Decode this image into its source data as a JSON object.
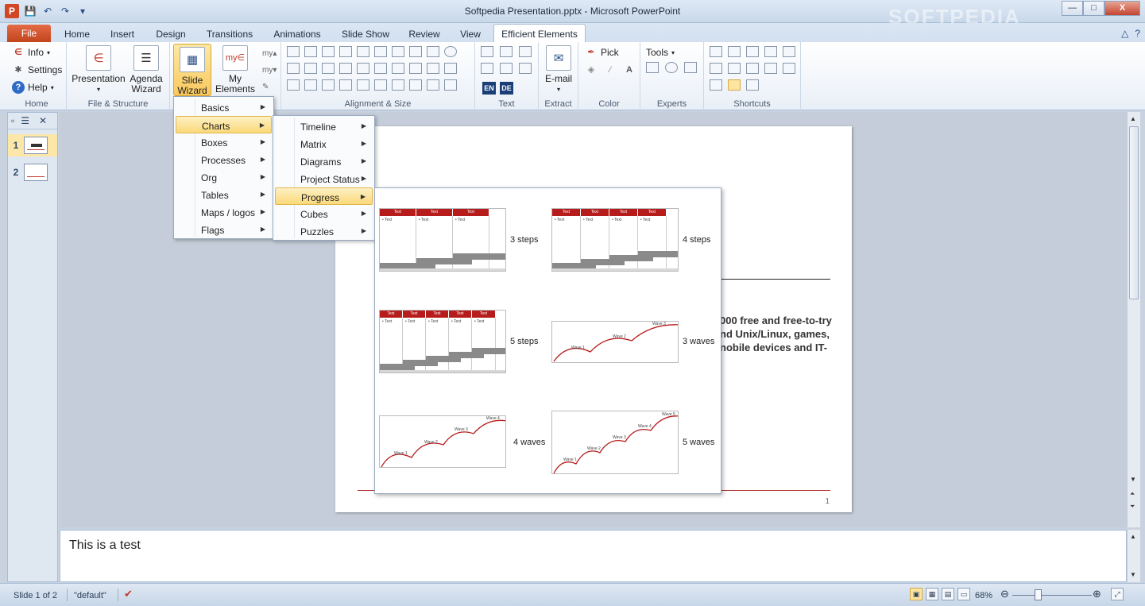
{
  "window": {
    "title": "Softpedia Presentation.pptx - Microsoft PowerPoint",
    "watermark": "SOFTPEDIA",
    "controls": [
      "—",
      "□",
      "X"
    ]
  },
  "qat": {
    "logo": "P",
    "save": "💾",
    "undo": "↶",
    "redo": "↷",
    "more": "▾"
  },
  "tabs": [
    "File",
    "Home",
    "Insert",
    "Design",
    "Transitions",
    "Animations",
    "Slide Show",
    "Review",
    "View",
    "Efficient Elements"
  ],
  "ribbon": {
    "home_group": {
      "info": "Info",
      "settings": "Settings",
      "help": "Help",
      "label": "Home"
    },
    "file_group": {
      "presentation": "Presentation",
      "agenda1": "Agenda",
      "agenda2": "Wizard",
      "label": "File & Structure"
    },
    "slide_wizard": {
      "line1": "Slide",
      "line2": "Wizard"
    },
    "my_elements": {
      "line1": "My",
      "line2": "Elements",
      "icon": "my∈"
    },
    "alignment_label": "Alignment & Size",
    "text_group": {
      "en": "EN",
      "de": "DE",
      "label": "Text"
    },
    "extract_group": {
      "email": "E-mail",
      "label": "Extract"
    },
    "color_group": {
      "pick": "Pick",
      "label": "Color"
    },
    "experts_group": {
      "tools": "Tools",
      "label": "Experts"
    },
    "shortcuts_label": "Shortcuts"
  },
  "menu1": {
    "items": [
      "Basics",
      "Charts",
      "Boxes",
      "Processes",
      "Org",
      "Tables",
      "Maps / logos",
      "Flags"
    ],
    "highlighted": "Charts"
  },
  "menu2": {
    "items": [
      "Timeline",
      "Matrix",
      "Diagrams",
      "Project Status",
      "Progress",
      "Cubes",
      "Puzzles"
    ],
    "highlighted": "Progress"
  },
  "gallery": {
    "items": [
      {
        "label": "3 steps",
        "head": "Text",
        "bullet": "• Text"
      },
      {
        "label": "4 steps",
        "head": "Text",
        "bullet": "• Text"
      },
      {
        "label": "5 steps",
        "head": "Text",
        "bullet": "• Text"
      },
      {
        "label": "3 waves",
        "waves": [
          "Wave 1",
          "Wave 2",
          "Wave 3"
        ]
      },
      {
        "label": "4 waves",
        "waves": [
          "Wave 1",
          "Wave 2",
          "Wave 3",
          "Wave 4"
        ]
      },
      {
        "label": "5 waves",
        "waves": [
          "Wave 1",
          "Wave 2",
          "Wave 3",
          "Wave 4",
          "Wave 5"
        ]
      }
    ]
  },
  "slide": {
    "body_lines": [
      "000 free and free-to-try",
      "nd Unix/Linux, games,",
      "nobile devices and IT-"
    ],
    "page_number": "1"
  },
  "thumbnails": [
    "1",
    "2"
  ],
  "notes": {
    "text": "This is a test"
  },
  "status": {
    "slide_info": "Slide 1 of 2",
    "theme": "\"default\"",
    "zoom": "68%"
  }
}
